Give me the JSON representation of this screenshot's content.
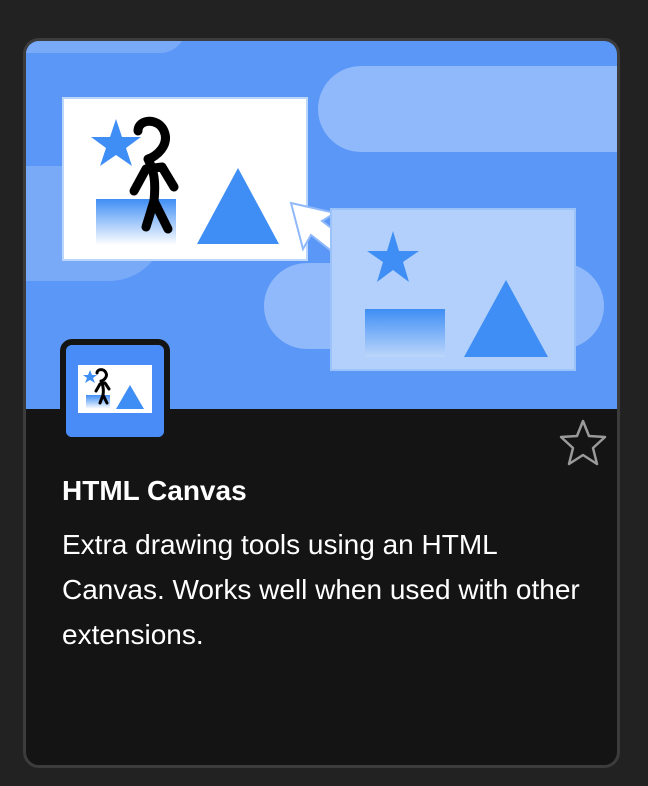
{
  "extension": {
    "title": "HTML Canvas",
    "description": "Extra drawing tools using an HTML Canvas. Works well when used with other extensions.",
    "favorite_icon": "star-outline-icon"
  },
  "colors": {
    "banner_background": "#5b97f6",
    "card_background": "#141414",
    "card_border": "#3c3c3c",
    "accent_blue": "#3f8ef5",
    "text": "#ffffff"
  }
}
